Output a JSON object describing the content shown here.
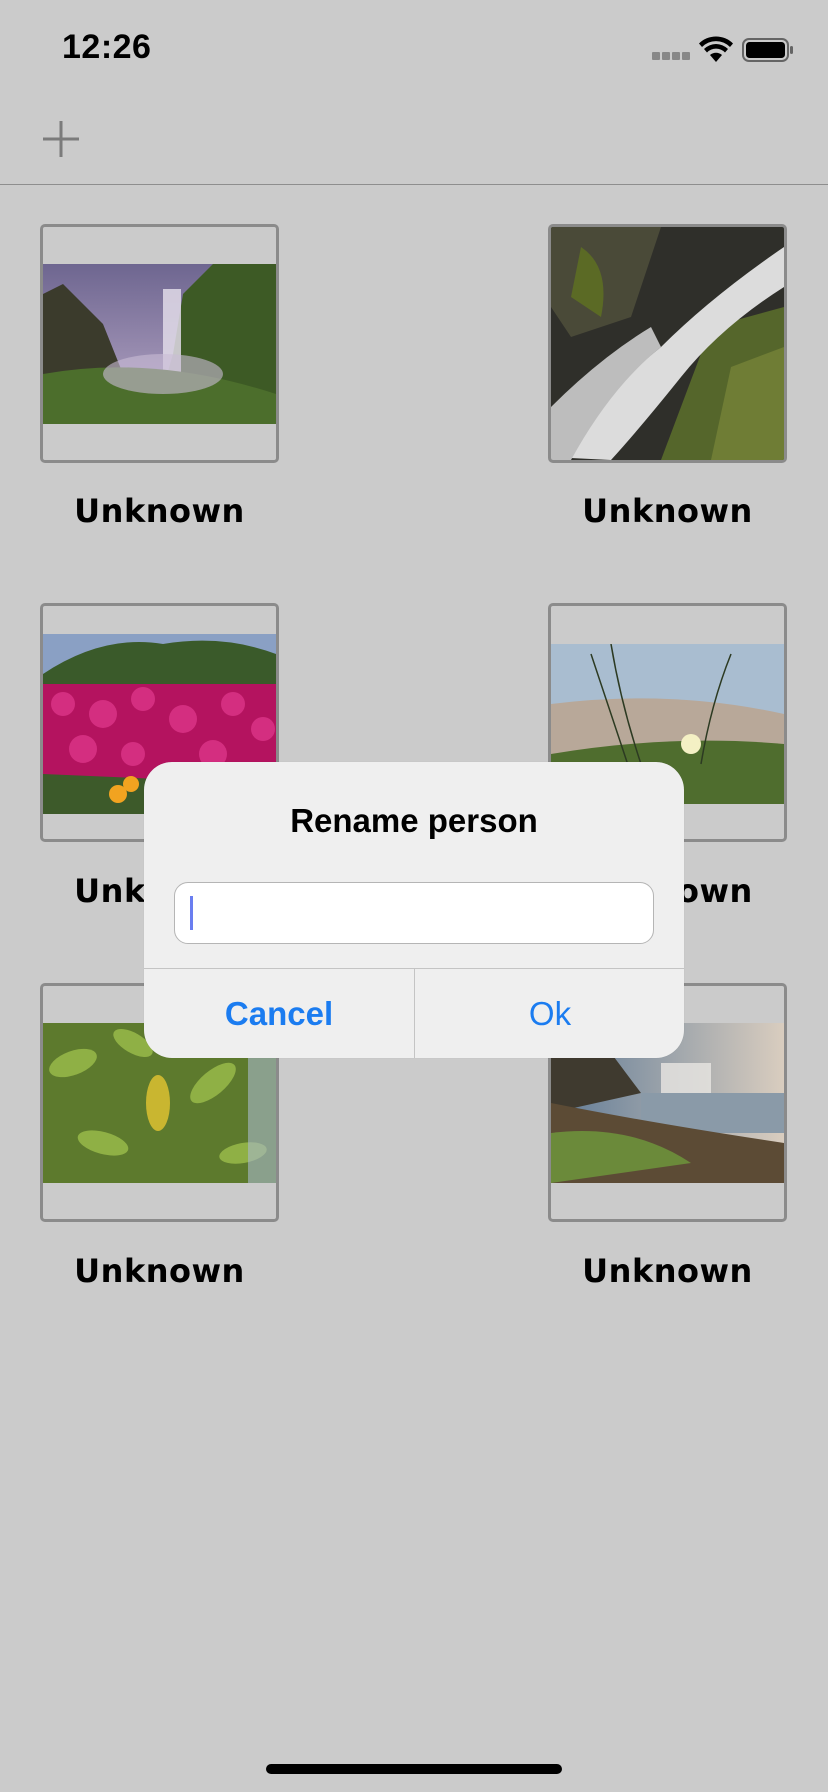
{
  "status_bar": {
    "time": "12:26",
    "icons": [
      "signal-icon",
      "wifi-icon",
      "battery-icon"
    ]
  },
  "nav_bar": {
    "add_icon": "plus-icon"
  },
  "grid": {
    "items": [
      {
        "caption": "Unknown",
        "photo": "waterfall-valley"
      },
      {
        "caption": "Unknown",
        "photo": "waterfall-closeup"
      },
      {
        "caption": "Unknown",
        "photo": "pink-flowers"
      },
      {
        "caption": "Unknown",
        "photo": "beach-grass"
      },
      {
        "caption": "Unknown",
        "photo": "green-leaves"
      },
      {
        "caption": "Unknown",
        "photo": "waterfall-rocks"
      }
    ]
  },
  "dialog": {
    "title": "Rename person",
    "input_value": "",
    "cancel_label": "Cancel",
    "ok_label": "Ok"
  },
  "colors": {
    "accent": "#1b7cf0",
    "background": "#cbcbcb",
    "dialog": "#efefef"
  }
}
